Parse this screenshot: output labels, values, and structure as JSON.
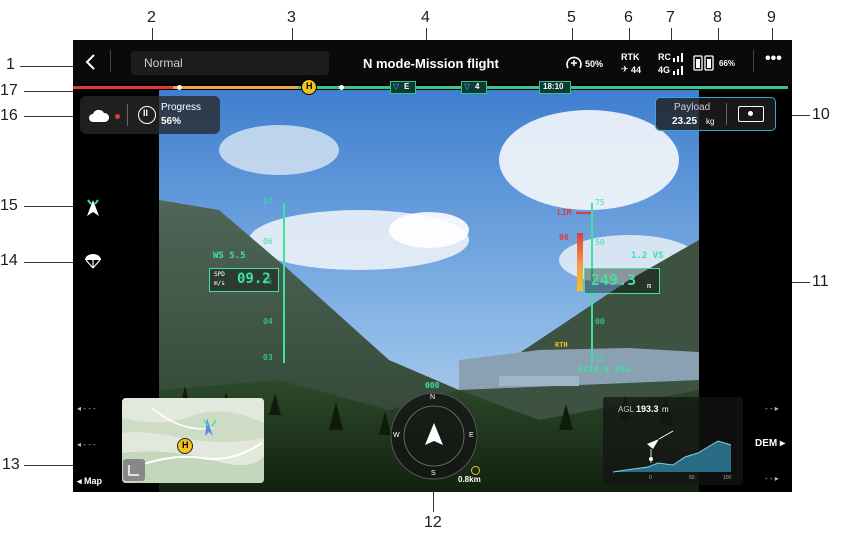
{
  "callouts": [
    "1",
    "2",
    "3",
    "4",
    "5",
    "6",
    "7",
    "8",
    "9",
    "10",
    "11",
    "12",
    "13",
    "14",
    "15",
    "16",
    "17"
  ],
  "topbar": {
    "back_icon": "chevron-left-icon",
    "status_mode": "Normal",
    "title": "N mode-Mission flight",
    "battery_label": "50%",
    "rtk_label": "RTK",
    "rtk_count": "44",
    "rc_label": "RC",
    "net_label": "4G",
    "rc_battery": "66%",
    "more_icon": "ellipsis-icon"
  },
  "timeline": {
    "marker_h": "H",
    "marker_e": "E",
    "marker_4": "4",
    "time": "18:10"
  },
  "progress_panel": {
    "label": "Progress",
    "value": "56%",
    "fraction": 0.56
  },
  "payload_panel": {
    "label": "Payload",
    "value": "23.25",
    "unit": "kg"
  },
  "hud": {
    "ws": "WS 5.5",
    "spd_label": "SPD",
    "spd_unit": "m/s",
    "spd_value": "09.2",
    "speed_ticks": [
      "07",
      "06",
      "05",
      "04",
      "03"
    ],
    "alt_ticks": [
      "75",
      "50",
      "00",
      "25"
    ],
    "lim": "LIM",
    "alt_marker": "06",
    "vs": "1.2 VS",
    "alt_value": "249.3",
    "alt_unit": "m",
    "asl": "3244.9 ASL",
    "rth": "RTH"
  },
  "compass": {
    "heading": "000",
    "distance": "0.8km",
    "letters": [
      "N",
      "E",
      "S",
      "W"
    ]
  },
  "side_left": {
    "arrow1": "◂ - - -",
    "arrow2": "◂ - - -",
    "map_label": "◂ Map"
  },
  "side_right": {
    "arrow1": "- - ▸",
    "dem_label": "DEM ▸",
    "arrow2": "- - ▸"
  },
  "alt_profile": {
    "agl_label": "AGL",
    "agl_value": "193.3",
    "agl_unit": "m",
    "ticks": [
      "0",
      "50",
      "100"
    ]
  },
  "minimap": {
    "home_marker": "H"
  },
  "icons": {
    "cloud": "cloud-icon",
    "pause": "pause-icon",
    "aircraft": "aircraft-icon",
    "parachute": "parachute-icon",
    "layers": "layers-icon"
  },
  "colors": {
    "hud_green": "#3fe0a0",
    "warn_red": "#e03a3a",
    "home_yellow": "#f3c31a"
  }
}
